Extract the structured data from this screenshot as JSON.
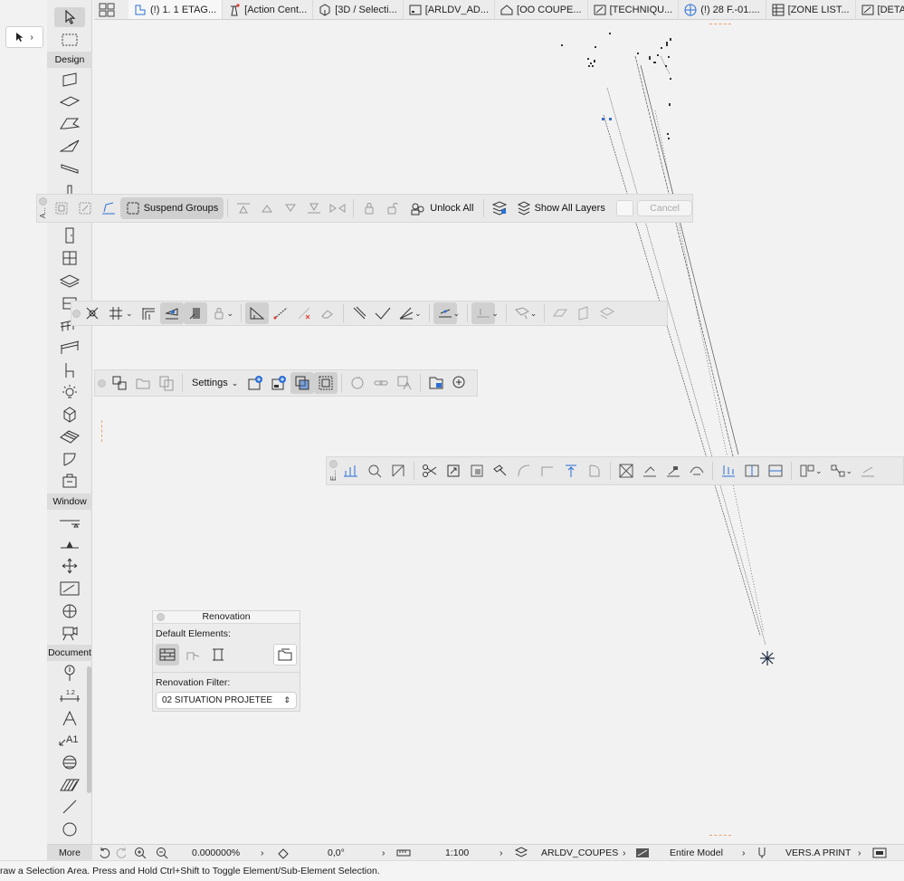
{
  "tabs": [
    {
      "label": "(!) 1. 1 ETAG...",
      "icon": "floor-plan-icon"
    },
    {
      "label": "[Action Cent...",
      "icon": "lighthouse-icon"
    },
    {
      "label": "[3D / Selecti...",
      "icon": "3d-box-icon"
    },
    {
      "label": "[ARLDV_AD...",
      "icon": "layout-icon"
    },
    {
      "label": "[OO COUPE...",
      "icon": "section-icon"
    },
    {
      "label": "[TECHNIQU...",
      "icon": "detail-icon"
    },
    {
      "label": "(!) 28 F.-01....",
      "icon": "globe-icon"
    },
    {
      "label": "[ZONE LIST...",
      "icon": "table-icon"
    },
    {
      "label": "[DETA",
      "icon": "detail-icon"
    }
  ],
  "toolbox": {
    "sections": {
      "design": "Design",
      "window": "Window",
      "document": "Document",
      "more": "More"
    }
  },
  "group_palette": {
    "side_label": "A...",
    "suspend_groups": "Suspend Groups",
    "unlock_all": "Unlock All",
    "show_all_layers": "Show All Layers",
    "cancel": "Cancel"
  },
  "settings_palette": {
    "settings": "Settings"
  },
  "edit_palette": {
    "side_label": "E..."
  },
  "renovation": {
    "title": "Renovation",
    "default_elements": "Default Elements:",
    "filter_label": "Renovation Filter:",
    "filter_value": "02 SITUATION PROJETEE"
  },
  "statusbar": {
    "angle_value": "0.000000%",
    "rotation_value": "0,0°",
    "scale": "1:100",
    "layer_combo": "ARLDV_COUPES",
    "model_view": "Entire Model",
    "pen_set": "VERS.A PRINT"
  },
  "info_text": "raw a Selection Area. Press and Hold Ctrl+Shift to Toggle Element/Sub-Element Selection."
}
